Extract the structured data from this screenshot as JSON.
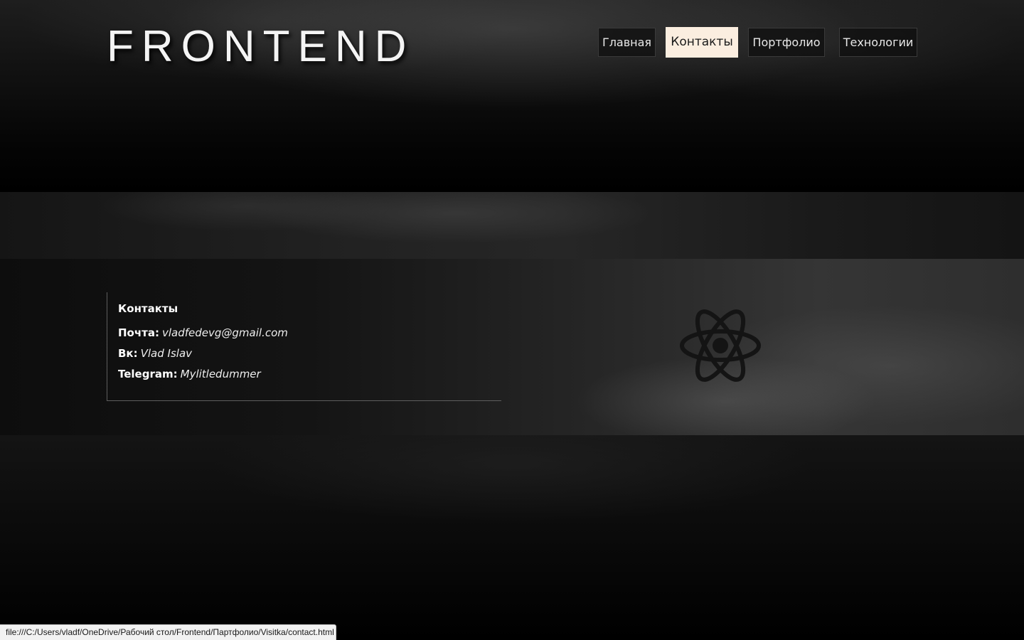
{
  "header": {
    "logo": "FRONTEND",
    "nav": [
      {
        "label": "Главная",
        "active": false
      },
      {
        "label": "Контакты",
        "active": true
      },
      {
        "label": "Портфолио",
        "active": false
      },
      {
        "label": "Технологии",
        "active": false
      }
    ]
  },
  "contacts": {
    "title": "Контакты",
    "items": [
      {
        "label": "Почта:",
        "value": "vladfedevg@gmail.com"
      },
      {
        "label": "Вк:",
        "value": "Vlad Islav"
      },
      {
        "label": "Telegram:",
        "value": "Mylitledummer"
      }
    ],
    "icon": "atom-icon"
  },
  "status_bar": {
    "url": "file:///C:/Users/vladf/OneDrive/Рабочий стол/Frontend/Партфолио/Visitka/contact.html"
  },
  "colors": {
    "active_nav_bg": "#fbeee0",
    "text": "#ffffff",
    "background": "#000000"
  }
}
